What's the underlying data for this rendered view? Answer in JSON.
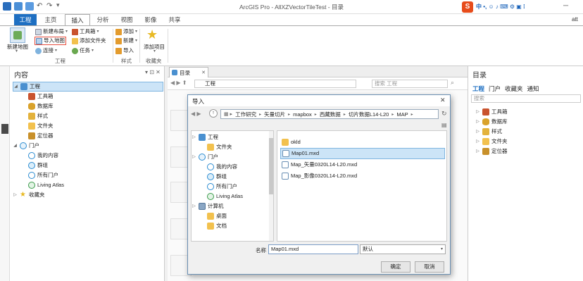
{
  "app": {
    "title": "ArcGIS Pro - AllXZVectorTileTest - 目录",
    "user_fragment": "att"
  },
  "tabs": [
    "工程",
    "主页",
    "插入",
    "分析",
    "视图",
    "影像",
    "共享"
  ],
  "ribbon": {
    "new_map": "新建地图",
    "new_layout": "新建布局",
    "import_map": "导入地图",
    "connect": "连接",
    "toolbox": "工具箱",
    "add_folder": "添加文件夹",
    "task": "任务",
    "add": "添加",
    "new": "新建",
    "import": "导入",
    "add_item": "添加项目",
    "group_project": "工程",
    "group_style": "样式",
    "group_favorites": "收藏夹"
  },
  "contents": {
    "title": "内容",
    "items": [
      {
        "label": "工程",
        "icon": "project-icon",
        "level": 0,
        "expanded": true,
        "selected": true
      },
      {
        "label": "工具箱",
        "icon": "toolbox-icon",
        "level": 1
      },
      {
        "label": "数据库",
        "icon": "database-icon",
        "level": 1
      },
      {
        "label": "样式",
        "icon": "style-icon",
        "level": 1
      },
      {
        "label": "文件夹",
        "icon": "folder-icon",
        "level": 1
      },
      {
        "label": "定位器",
        "icon": "locator-icon",
        "level": 1
      },
      {
        "label": "门户",
        "icon": "portal-icon",
        "level": 0,
        "expanded": true
      },
      {
        "label": "我的内容",
        "icon": "my-content-icon",
        "level": 1
      },
      {
        "label": "群组",
        "icon": "groups-icon",
        "level": 1
      },
      {
        "label": "所有门户",
        "icon": "all-portal-icon",
        "level": 1
      },
      {
        "label": "Living Atlas",
        "icon": "living-atlas-icon",
        "level": 1
      },
      {
        "label": "收藏夹",
        "icon": "star-icon",
        "level": 0
      }
    ]
  },
  "catalog_view": {
    "tab": "目录",
    "path": "工程",
    "search_placeholder": "搜索 工程"
  },
  "catalog_pane": {
    "title": "目录",
    "tabs": [
      "工程",
      "门户",
      "收藏夹",
      "通知"
    ],
    "search_placeholder": "搜索",
    "items": [
      "工具箱",
      "数据库",
      "样式",
      "文件夹",
      "定位器"
    ]
  },
  "dialog": {
    "title": "导入",
    "breadcrumb": [
      "工作研究",
      "矢量切片",
      "mapbox",
      "西藏数据",
      "切片数据L14-L20",
      "MAP"
    ],
    "tree": [
      {
        "label": "工程",
        "icon": "project-icon",
        "level": 0
      },
      {
        "label": "文件夹",
        "icon": "folder-icon",
        "level": 1
      },
      {
        "label": "门户",
        "icon": "portal-icon",
        "level": 0
      },
      {
        "label": "我的内容",
        "icon": "my-content-icon",
        "level": 1
      },
      {
        "label": "群组",
        "icon": "groups-icon",
        "level": 1
      },
      {
        "label": "所有门户",
        "icon": "all-portal-icon",
        "level": 1
      },
      {
        "label": "Living Atlas",
        "icon": "living-atlas-icon",
        "level": 1
      },
      {
        "label": "计算机",
        "icon": "computer-icon",
        "level": 0
      },
      {
        "label": "桌面",
        "icon": "folder-icon",
        "level": 1
      },
      {
        "label": "文档",
        "icon": "folder-icon",
        "level": 1
      }
    ],
    "files": [
      {
        "name": "okld",
        "type": "folder"
      },
      {
        "name": "Map01.mxd",
        "type": "mxd",
        "selected": true
      },
      {
        "name": "Map_矢量0320L14-L20.mxd",
        "type": "mxd"
      },
      {
        "name": "Map_影像0320L14-L20.mxd",
        "type": "mxd"
      }
    ],
    "name_label": "名称",
    "name_value": "Map01.mxd",
    "filter_value": "默认",
    "ok": "确定",
    "cancel": "取消"
  },
  "colors": {
    "accent": "#1e6fc2",
    "selection": "#cce4f7",
    "folder": "#f2c14e"
  }
}
